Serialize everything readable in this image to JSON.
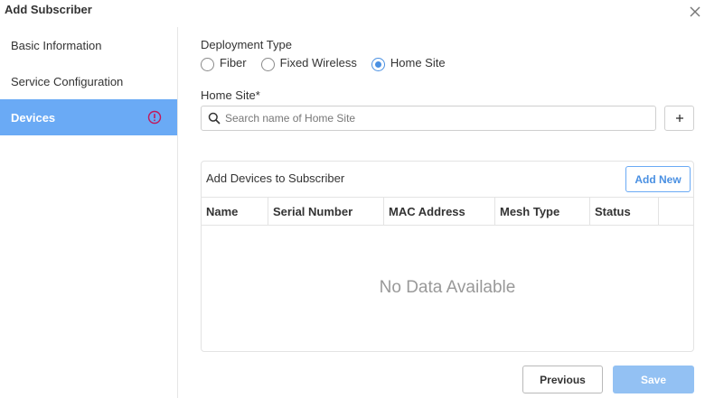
{
  "dialog": {
    "title": "Add Subscriber"
  },
  "sidebar": {
    "items": [
      {
        "label": "Basic Information",
        "active": false
      },
      {
        "label": "Service Configuration",
        "active": false
      },
      {
        "label": "Devices",
        "active": true,
        "icon": "warning-circle-icon"
      }
    ]
  },
  "deployment": {
    "label": "Deployment Type",
    "options": [
      "Fiber",
      "Fixed Wireless",
      "Home Site"
    ],
    "selected": "Home Site"
  },
  "home_site": {
    "label": "Home Site*",
    "placeholder": "Search name of Home Site",
    "value": ""
  },
  "devices": {
    "title": "Add Devices to Subscriber",
    "add_new_label": "Add New",
    "columns": [
      "Name",
      "Serial Number",
      "MAC Address",
      "Mesh Type",
      "Status",
      ""
    ],
    "rows": [],
    "empty_text": "No Data Available"
  },
  "footer": {
    "previous_label": "Previous",
    "save_label": "Save"
  },
  "colors": {
    "accent": "#6aaaf5",
    "save_button": "#93c1f3",
    "warning": "#c2185b",
    "radio_selected": "#4a90e2"
  }
}
